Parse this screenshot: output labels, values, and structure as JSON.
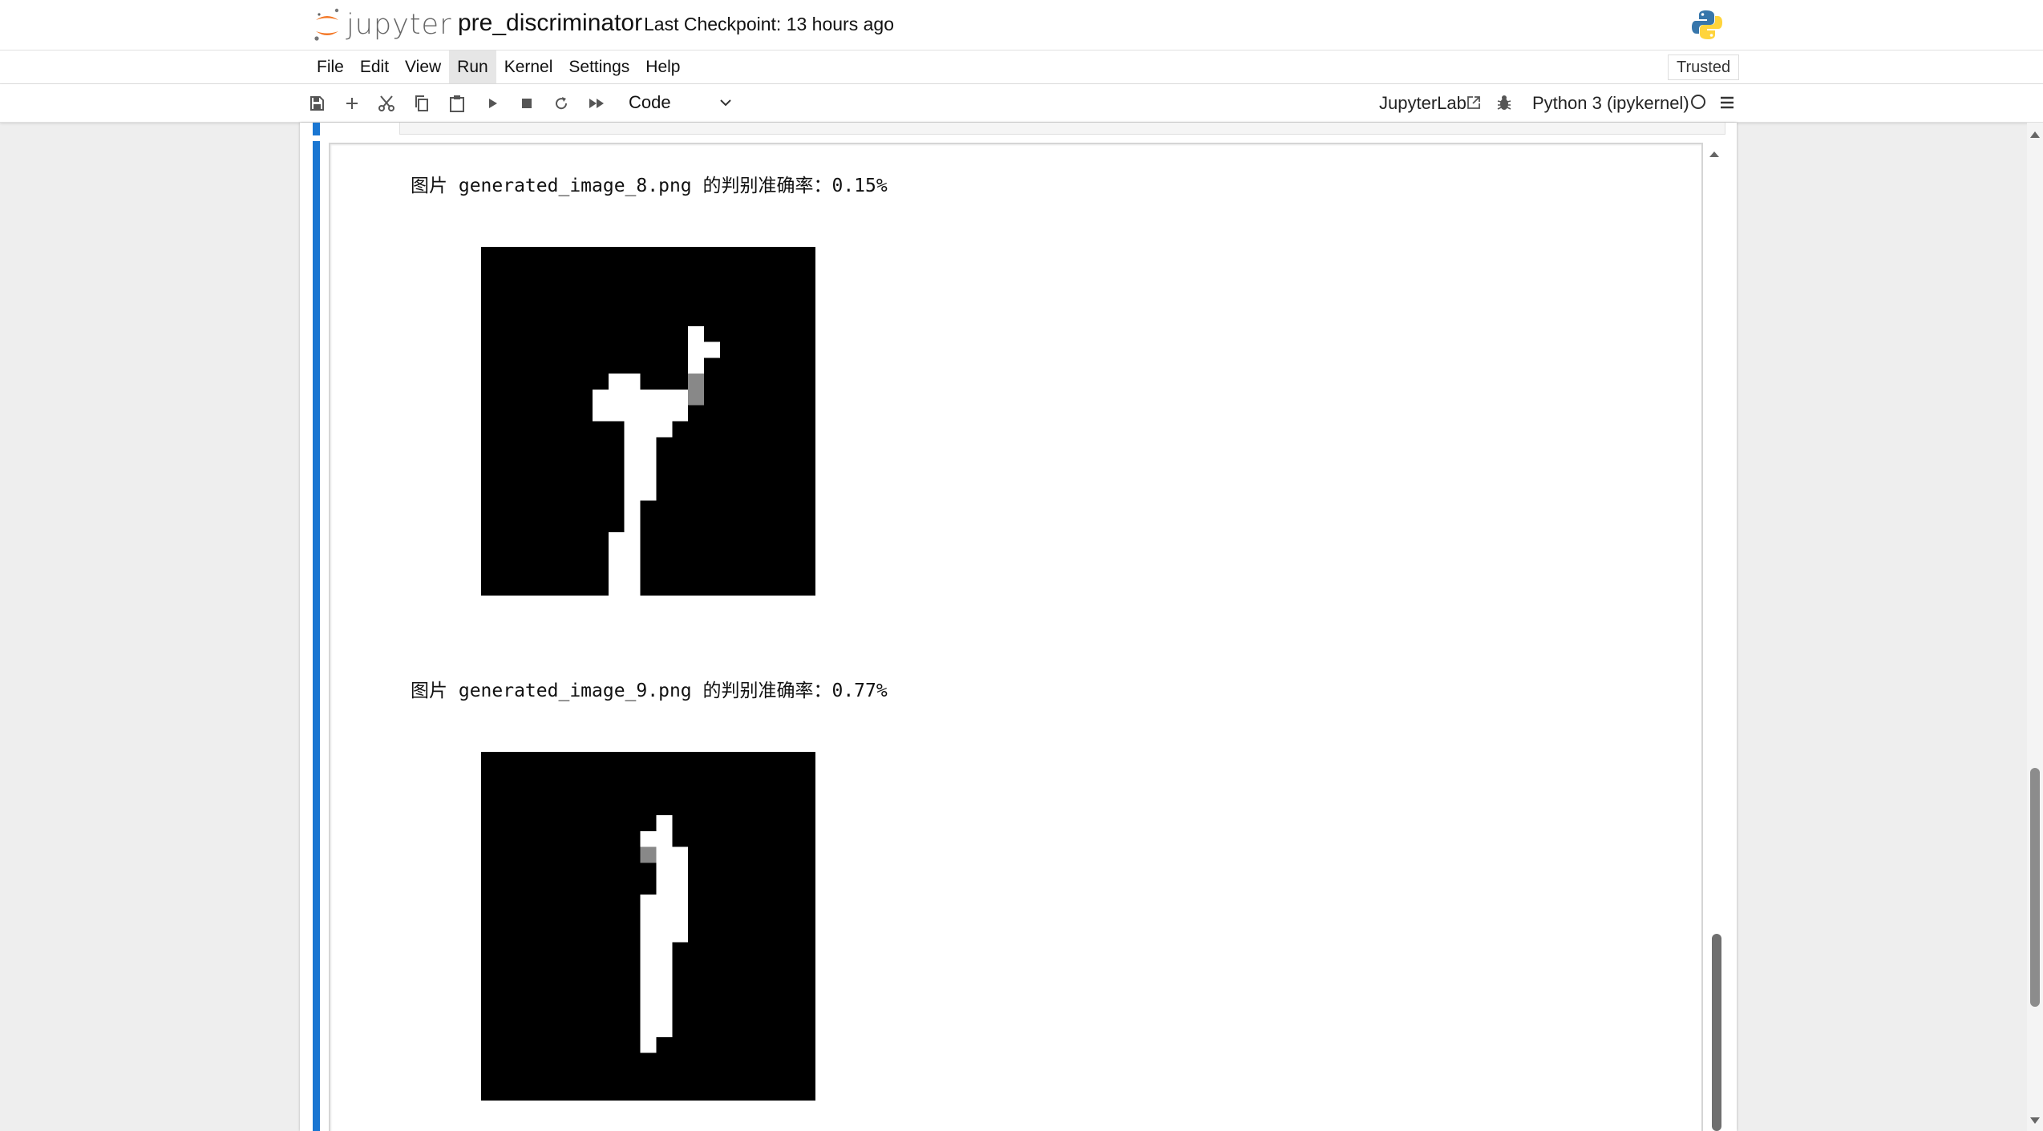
{
  "header": {
    "logo_text": "jupyter",
    "notebook_title": "pre_discriminator",
    "checkpoint": "Last Checkpoint: 13 hours ago"
  },
  "menu": {
    "items": [
      "File",
      "Edit",
      "View",
      "Run",
      "Kernel",
      "Settings",
      "Help"
    ],
    "active": "Run",
    "trusted": "Trusted"
  },
  "toolbar": {
    "cell_type": "Code",
    "jupyterlab_link": "JupyterLab",
    "kernel_name": "Python 3 (ipykernel)",
    "icons": [
      "save-icon",
      "add-icon",
      "cut-icon",
      "copy-icon",
      "paste-icon",
      "run-icon",
      "stop-icon",
      "restart-icon",
      "fast-forward-icon"
    ]
  },
  "outputs": [
    {
      "text": "图片 generated_image_8.png 的判别准确率：0.15%"
    },
    {
      "text": "图片 generated_image_9.png 的判别准确率：0.77%"
    }
  ],
  "colors": {
    "accent": "#1976d2",
    "jupyter_orange": "#f37726"
  }
}
